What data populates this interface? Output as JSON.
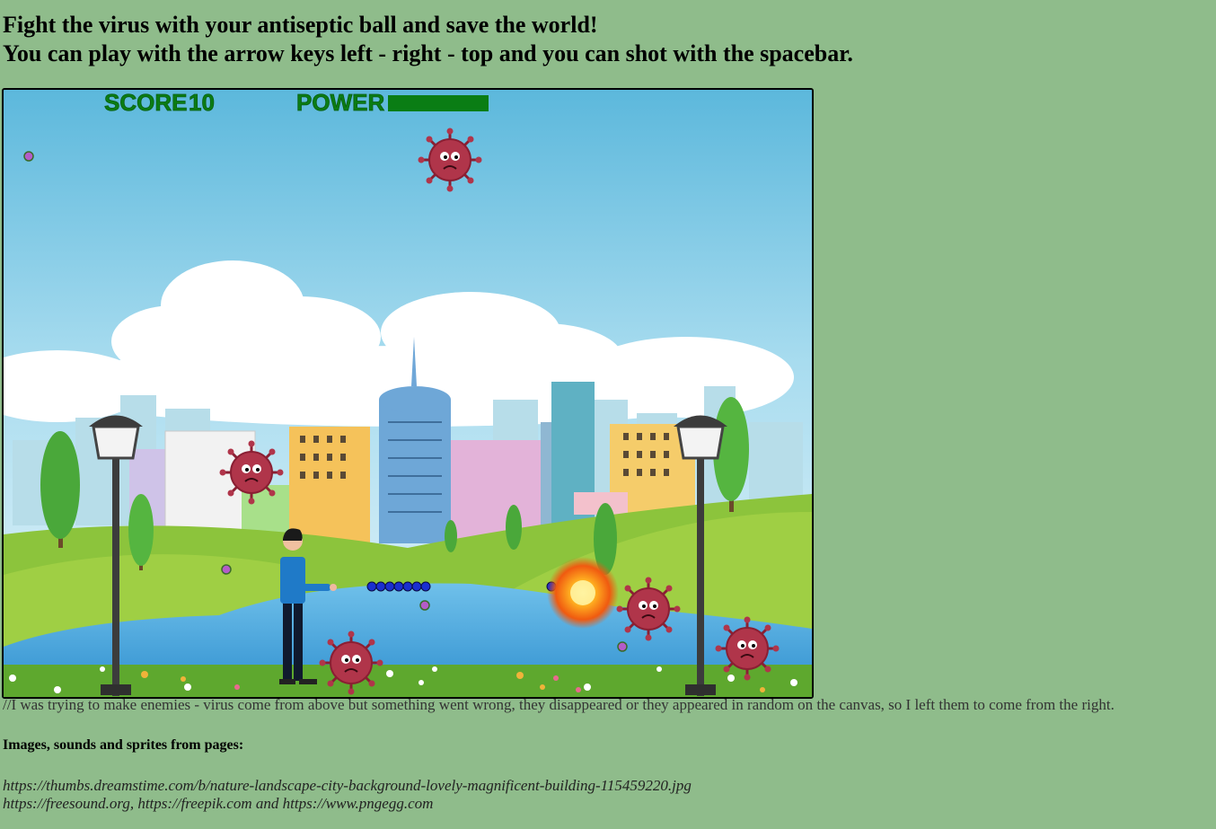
{
  "header": {
    "line1": "Fight the virus with your antiseptic ball and save the world!",
    "line2": "You can play with the arrow keys left - right - top and you can shot with the spacebar."
  },
  "game": {
    "score_label": "SCORE",
    "score_value": "10",
    "power_label": "POWER",
    "power_level": 1.0,
    "colors": {
      "hud": "#0a7d14",
      "sky_top": "#5cb8dc",
      "sky_bottom": "#dff2f8",
      "grass": "#8cc43c",
      "lake": "#4ba6dc",
      "virus": "#b0354a"
    }
  },
  "footer": {
    "note": "//I was trying to make enemies - virus come from above but something went wrong, they disappeared or they appeared in random on the canvas, so I left them to come from the right.",
    "credits_title": "Images, sounds and sprites from pages:",
    "link1": "https://thumbs.dreamstime.com/b/nature-landscape-city-background-lovely-magnificent-building-115459220.jpg",
    "link2": "https://freesound.org, https://freepik.com and https://www.pngegg.com"
  }
}
